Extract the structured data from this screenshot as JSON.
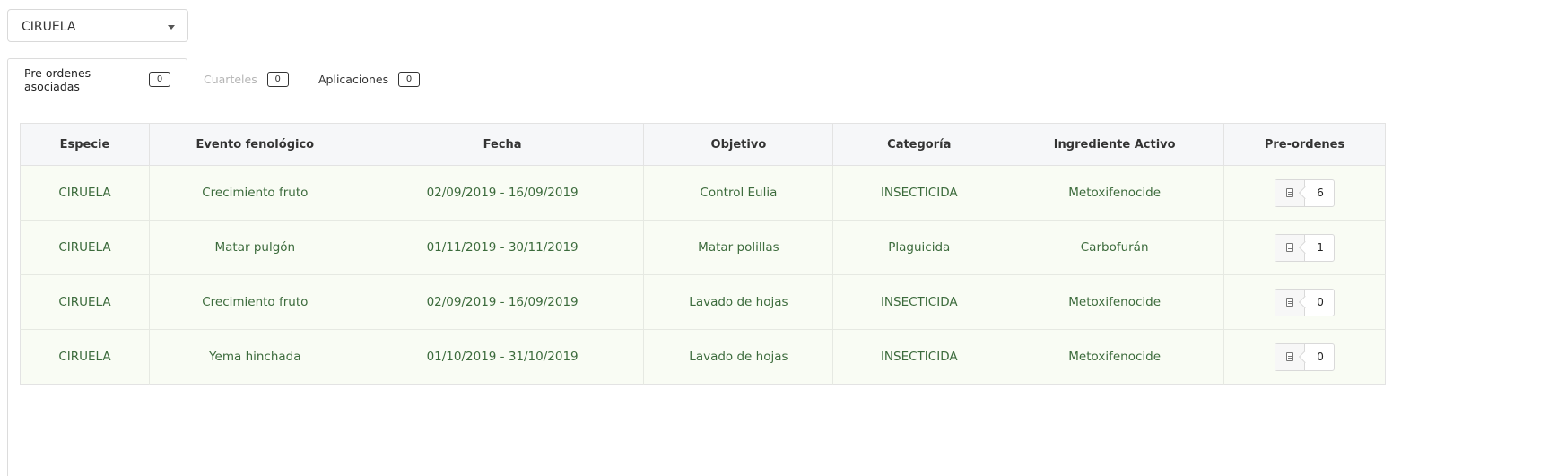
{
  "species_select": {
    "value": "CIRUELA"
  },
  "tabs": [
    {
      "label": "Pre ordenes asociadas",
      "count": "0",
      "state": "active"
    },
    {
      "label": "Cuarteles",
      "count": "0",
      "state": "disabled"
    },
    {
      "label": "Aplicaciones",
      "count": "0",
      "state": "normal"
    }
  ],
  "table": {
    "headers": [
      "Especie",
      "Evento fenológico",
      "Fecha",
      "Objetivo",
      "Categoría",
      "Ingrediente Activo",
      "Pre-ordenes"
    ],
    "rows": [
      {
        "especie": "CIRUELA",
        "evento": "Crecimiento fruto",
        "fecha": "02/09/2019 - 16/09/2019",
        "objetivo": "Control Eulia",
        "categoria": "INSECTICIDA",
        "ingrediente": "Metoxifenocide",
        "preordenes": "6"
      },
      {
        "especie": "CIRUELA",
        "evento": "Matar pulgón",
        "fecha": "01/11/2019 - 30/11/2019",
        "objetivo": "Matar polillas",
        "categoria": "Plaguicida",
        "ingrediente": "Carbofurán",
        "preordenes": "1"
      },
      {
        "especie": "CIRUELA",
        "evento": "Crecimiento fruto",
        "fecha": "02/09/2019 - 16/09/2019",
        "objetivo": "Lavado de hojas",
        "categoria": "INSECTICIDA",
        "ingrediente": "Metoxifenocide",
        "preordenes": "0"
      },
      {
        "especie": "CIRUELA",
        "evento": "Yema hinchada",
        "fecha": "01/10/2019 - 31/10/2019",
        "objetivo": "Lavado de hojas",
        "categoria": "INSECTICIDA",
        "ingrediente": "Metoxifenocide",
        "preordenes": "0"
      }
    ]
  },
  "colors": {
    "cell_text": "#3c6b3c",
    "row_background": "#f9fcf4",
    "header_background": "#f6f7f9",
    "disabled_tab": "#b5b5b5"
  },
  "icons": {
    "preorden_button": "document-icon",
    "select_caret": "caret-down-icon"
  }
}
